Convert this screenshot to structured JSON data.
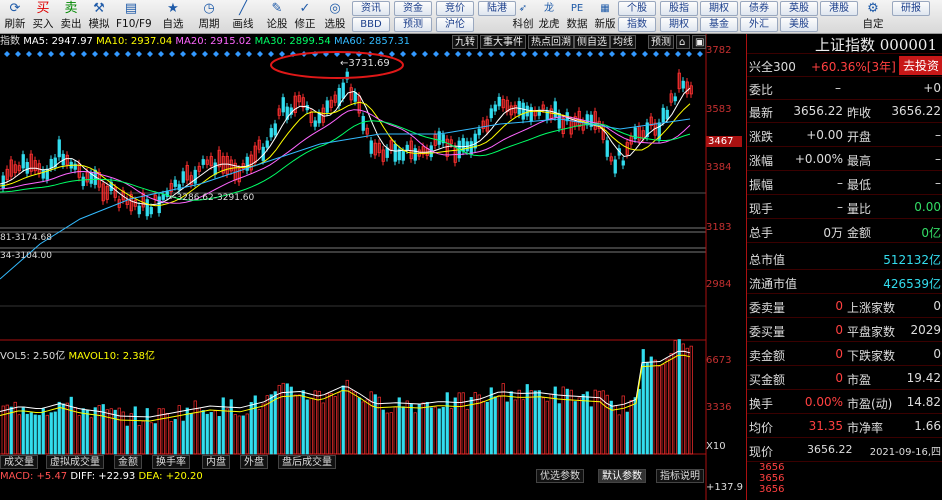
{
  "toolbar": {
    "buttons": [
      {
        "label": "刷新",
        "icon": "refresh-icon"
      },
      {
        "label": "买入",
        "icon": "buy-icon"
      },
      {
        "label": "卖出",
        "icon": "sell-icon"
      },
      {
        "label": "模拟",
        "icon": "hammer-icon"
      },
      {
        "label": "F10/F9",
        "icon": "f10-icon"
      },
      {
        "label": "自选",
        "icon": "star-icon"
      },
      {
        "label": "周期",
        "icon": "clock-icon"
      },
      {
        "label": "画线",
        "icon": "draw-line-icon"
      },
      {
        "label": "论股",
        "icon": "comment-icon"
      },
      {
        "label": "修正",
        "icon": "correct-icon"
      },
      {
        "label": "选股",
        "icon": "select-stock-icon"
      }
    ],
    "small": [
      [
        "资讯",
        "BBD"
      ],
      [
        "资金",
        "预测"
      ],
      [
        "竞价",
        "沪伦"
      ],
      [
        "陆港",
        ""
      ]
    ],
    "mid": [
      {
        "label": "科创",
        "icon": "rocket-icon"
      },
      {
        "label": "龙虎",
        "icon": "dragon-icon"
      },
      {
        "label": "数据",
        "icon": "pe-icon"
      },
      {
        "label": "新版",
        "icon": "new-icon"
      }
    ],
    "right": [
      [
        "个股",
        "指数"
      ],
      [
        "股指",
        "期权"
      ],
      [
        "期权",
        "基金"
      ],
      [
        "债券",
        "外汇"
      ],
      [
        "英股",
        "美股"
      ],
      [
        "港股",
        ""
      ],
      [
        "研报",
        ""
      ]
    ],
    "right_single": "自定"
  },
  "ma": {
    "prefix": "指数",
    "ma5": "MA5: 2947.97",
    "ma10": "MA10: 2937.04",
    "ma20": "MA20: 2915.02",
    "ma30": "MA30: 2899.54",
    "ma60": "MA60: 2857.31"
  },
  "tags": [
    "九转",
    "重大事件",
    "热点回溯",
    "侧自选",
    "均线",
    "预测"
  ],
  "annotations": {
    "high": "3731.69",
    "low1": "3286.62-3291.60",
    "low2": "81-3174.68",
    "low3": "34-3104.00"
  },
  "price_axis": [
    "3782",
    "3583",
    "3467",
    "3384",
    "3183",
    "2984"
  ],
  "vol": {
    "title": "VOL5: 2.50亿",
    "title2": "MAVOL10: 2.38亿",
    "axis": [
      "6673",
      "3336",
      "X10"
    ]
  },
  "bottom_tabs": [
    "成交量",
    "虚拟成交量",
    "金额",
    "换手率",
    "内盘",
    "外盘",
    "盘后成交量"
  ],
  "macd": {
    "macd": "MACD: +5.47",
    "diff": "DIFF: +22.93",
    "dea": "DEA: +20.20",
    "axis": "+137.9"
  },
  "macd_tabs": [
    "优选参数",
    "默认参数",
    "指标说明"
  ],
  "panel": {
    "title": "上证指数 000001",
    "xingquan": "兴全300",
    "xq_val": "+60.36%[3年]",
    "invest": "去投资",
    "weibi": "委比",
    "weibi_v": "–",
    "weibi_r": "+0",
    "rows": [
      {
        "l": "最新",
        "v": "3656.22",
        "l2": "昨收",
        "v2": "3656.22"
      },
      {
        "l": "涨跌",
        "v": "+0.00",
        "l2": "开盘",
        "v2": "–"
      },
      {
        "l": "涨幅",
        "v": "+0.00%",
        "l2": "最高",
        "v2": "–"
      },
      {
        "l": "振幅",
        "v": "–",
        "l2": "最低",
        "v2": "–"
      },
      {
        "l": "现手",
        "v": "–",
        "l2": "量比",
        "v2": "0.00"
      },
      {
        "l": "总手",
        "v": "0万",
        "l2": "金额",
        "v2": "0亿"
      }
    ],
    "zsz": "总市值",
    "zsz_v": "512132亿",
    "ltsz": "流通市值",
    "ltsz_v": "426539亿",
    "rows2": [
      {
        "l": "委卖量",
        "v": "0",
        "l2": "上涨家数",
        "v2": "0"
      },
      {
        "l": "委买量",
        "v": "0",
        "l2": "平盘家数",
        "v2": "2029"
      },
      {
        "l": "卖金额",
        "v": "0",
        "l2": "下跌家数",
        "v2": "0"
      },
      {
        "l": "买金额",
        "v": "0",
        "l2": "市盈",
        "v2": "19.42"
      },
      {
        "l": "换手",
        "v": "0.00%",
        "l2": "市盈(动)",
        "v2": "14.82"
      },
      {
        "l": "均价",
        "v": "31.35",
        "l2": "市净率",
        "v2": "1.66"
      }
    ],
    "xj": "现价",
    "xj_v": "3656.22",
    "date": "2021-09-16,四",
    "ticks": [
      "3656",
      "3656",
      "3656"
    ]
  },
  "colors": {
    "up": "#ff3030",
    "down": "#33ddee",
    "ma5": "#ffffff",
    "ma10": "#ffff00",
    "ma20": "#ff66ff",
    "ma30": "#00ff66",
    "ma60": "#33bbff"
  }
}
